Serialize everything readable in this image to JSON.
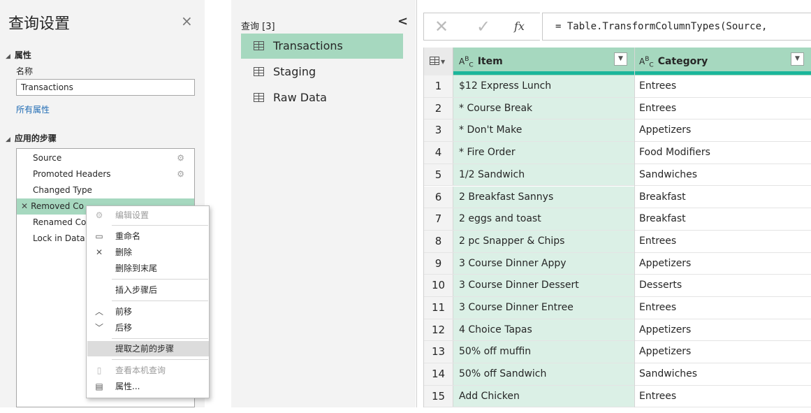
{
  "settings": {
    "title": "查询设置",
    "close_glyph": "×",
    "properties_header": "属性",
    "name_label": "名称",
    "name_value": "Transactions",
    "all_properties_link": "所有属性",
    "applied_steps_header": "应用的步骤",
    "steps": [
      {
        "label": "Source",
        "has_gear": true
      },
      {
        "label": "Promoted Headers",
        "has_gear": true
      },
      {
        "label": "Changed Type",
        "has_gear": false
      },
      {
        "label": "Removed Co",
        "has_gear": false,
        "selected": true
      },
      {
        "label": "Renamed Co",
        "has_gear": false
      },
      {
        "label": "Lock in Data",
        "has_gear": false
      }
    ]
  },
  "context_menu": {
    "items": [
      {
        "label": "编辑设置",
        "icon": "gear-icon",
        "disabled": true
      },
      {
        "label": "重命名",
        "icon": "rename-icon"
      },
      {
        "label": "删除",
        "icon": "delete-icon"
      },
      {
        "label": "删除到末尾",
        "icon": ""
      },
      {
        "label": "插入步骤后",
        "icon": ""
      },
      {
        "label": "前移",
        "icon": "chevron-up-icon"
      },
      {
        "label": "后移",
        "icon": "chevron-down-icon"
      },
      {
        "label": "提取之前的步骤",
        "icon": "",
        "highlighted": true
      },
      {
        "label": "查看本机查询",
        "icon": "document-icon",
        "disabled": true
      },
      {
        "label": "属性...",
        "icon": "properties-icon"
      }
    ]
  },
  "queries": {
    "title": "查询 [3]",
    "collapse_glyph": "<",
    "items": [
      {
        "label": "Transactions",
        "selected": true
      },
      {
        "label": "Staging"
      },
      {
        "label": "Raw Data"
      }
    ]
  },
  "formula_bar": {
    "fx_label": "fx",
    "formula": "= Table.TransformColumnTypes(Source,"
  },
  "grid": {
    "columns": [
      {
        "type_label": "ABC",
        "name": "Item"
      },
      {
        "type_label": "ABC",
        "name": "Category"
      }
    ],
    "rows": [
      {
        "n": "1",
        "item": "$12 Express Lunch",
        "category": "Entrees"
      },
      {
        "n": "2",
        "item": "* Course Break",
        "category": "Entrees"
      },
      {
        "n": "3",
        "item": "* Don't Make",
        "category": "Appetizers"
      },
      {
        "n": "4",
        "item": "* Fire Order",
        "category": "Food Modifiers"
      },
      {
        "n": "5",
        "item": "1/2 Sandwich",
        "category": "Sandwiches"
      },
      {
        "n": "6",
        "item": "2 Breakfast Sannys",
        "category": "Breakfast"
      },
      {
        "n": "7",
        "item": "2 eggs and toast",
        "category": "Breakfast"
      },
      {
        "n": "8",
        "item": "2 pc Snapper & Chips",
        "category": "Entrees"
      },
      {
        "n": "9",
        "item": "3 Course Dinner Appy",
        "category": "Appetizers"
      },
      {
        "n": "10",
        "item": "3 Course Dinner Dessert",
        "category": "Desserts"
      },
      {
        "n": "11",
        "item": "3 Course Dinner Entree",
        "category": "Entrees"
      },
      {
        "n": "12",
        "item": "4 Choice Tapas",
        "category": "Appetizers"
      },
      {
        "n": "13",
        "item": "50% off muffin",
        "category": "Appetizers"
      },
      {
        "n": "14",
        "item": "50% off Sandwich",
        "category": "Sandwiches"
      },
      {
        "n": "15",
        "item": "Add Chicken",
        "category": "Entrees"
      }
    ]
  },
  "colors": {
    "selection_green": "#a6d8bf",
    "item_column_tint": "#dbf0e6",
    "header_accent": "#1bb69b",
    "link_blue": "#1f6bb4"
  }
}
